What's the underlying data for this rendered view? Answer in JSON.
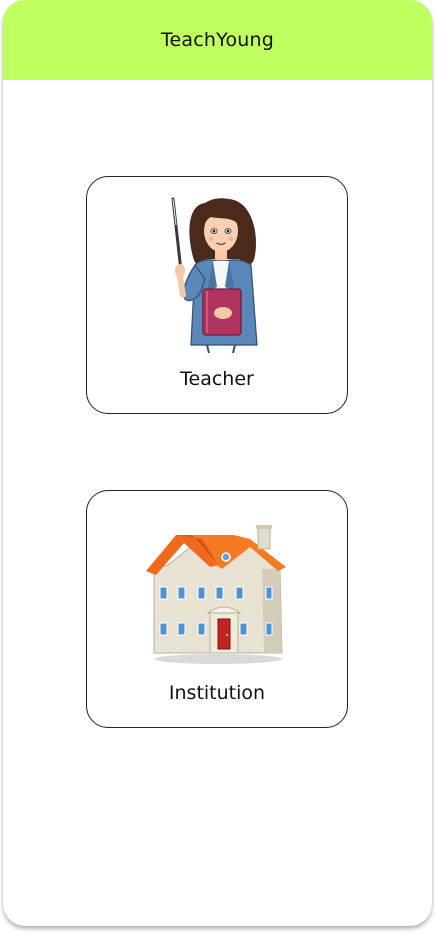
{
  "app": {
    "title": "TeachYoung",
    "header_color": "#c0ff60"
  },
  "options": [
    {
      "label": "Teacher",
      "icon": "teacher-illustration"
    },
    {
      "label": "Institution",
      "icon": "school-building-illustration"
    }
  ]
}
